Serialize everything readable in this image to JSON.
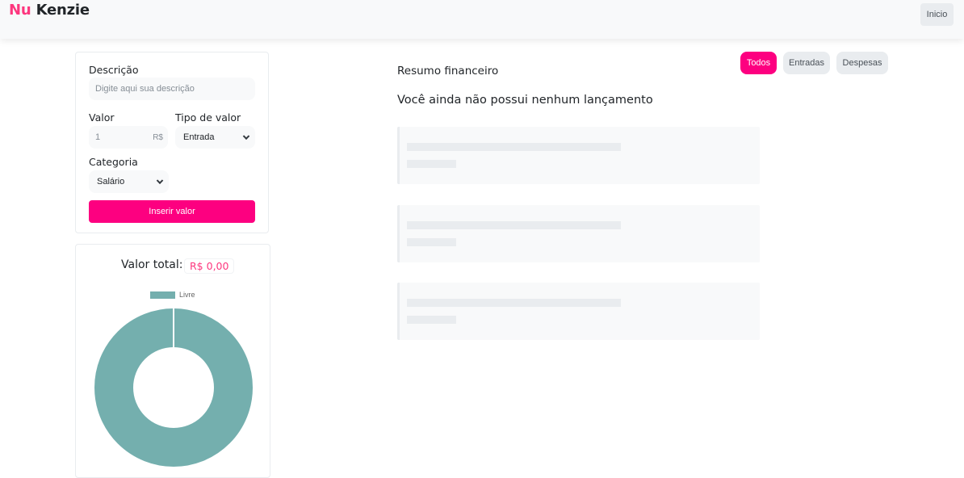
{
  "header": {
    "logo_part1": "Nu",
    "logo_part2": "Kenzie",
    "home_button": "Inicio"
  },
  "form": {
    "description_label": "Descrição",
    "description_placeholder": "Digite aqui sua descrição",
    "value_label": "Valor",
    "value_current": "1",
    "value_currency": "R$",
    "type_label": "Tipo de valor",
    "type_selected": "Entrada",
    "category_label": "Categoria",
    "category_selected": "Salário",
    "submit_label": "Inserir valor"
  },
  "total": {
    "label": "Valor total:",
    "value": "R$ 0,00"
  },
  "chart_data": {
    "type": "pie",
    "categories": [
      "Livre"
    ],
    "values": [
      100
    ],
    "colors": [
      "#74afae"
    ],
    "legend_position": "top"
  },
  "main": {
    "title": "Resumo financeiro",
    "empty_message": "Você ainda não possui nenhum lançamento",
    "filters": [
      "Todos",
      "Entradas",
      "Despesas"
    ],
    "active_filter": "Todos"
  },
  "colors": {
    "brand": "#fd0080",
    "chart_free": "#74afae"
  }
}
